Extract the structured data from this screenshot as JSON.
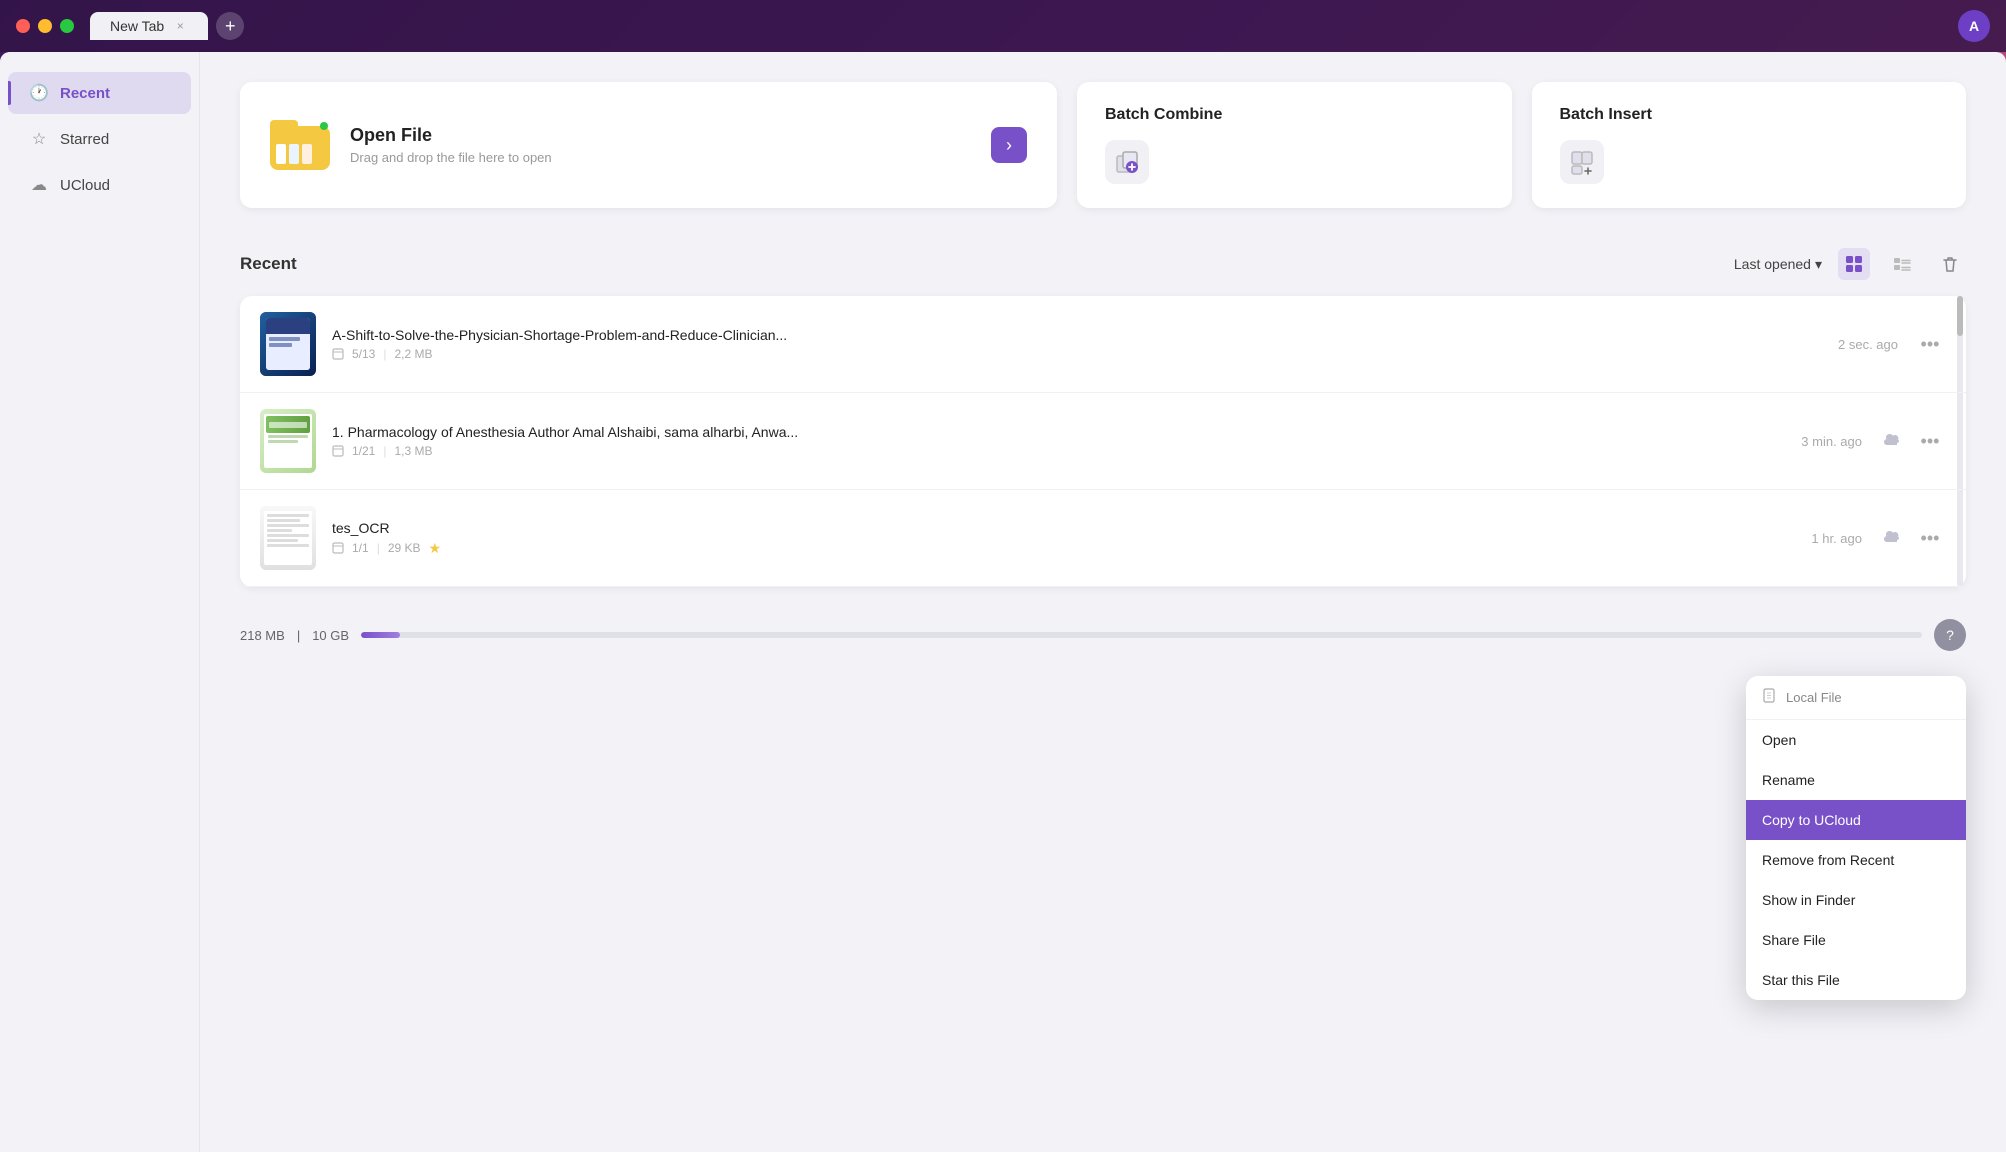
{
  "titlebar": {
    "tab_label": "New Tab",
    "tab_close_icon": "×",
    "tab_add_icon": "+",
    "avatar_label": "A"
  },
  "sidebar": {
    "items": [
      {
        "id": "recent",
        "label": "Recent",
        "icon": "🕐",
        "active": true
      },
      {
        "id": "starred",
        "label": "Starred",
        "icon": "☆",
        "active": false
      },
      {
        "id": "ucloud",
        "label": "UCloud",
        "icon": "☁",
        "active": false
      }
    ]
  },
  "quick_actions": {
    "open_file": {
      "title": "Open File",
      "subtitle": "Drag and drop the file here to open",
      "arrow": "›"
    },
    "batch_combine": {
      "title": "Batch Combine"
    },
    "batch_insert": {
      "title": "Batch Insert"
    }
  },
  "recent_section": {
    "title": "Recent",
    "sort_label": "Last opened",
    "sort_arrow": "▾"
  },
  "files": [
    {
      "name": "A-Shift-to-Solve-the-Physician-Shortage-Problem-and-Reduce-Clinician...",
      "pages": "5/13",
      "size": "2,2 MB",
      "time": "2 sec. ago",
      "has_cloud": false,
      "starred": false,
      "thumb_type": "medical"
    },
    {
      "name": "1. Pharmacology of Anesthesia Author Amal Alshaibi, sama alharbi, Anwa...",
      "pages": "1/21",
      "size": "1,3 MB",
      "time": "3 min. ago",
      "has_cloud": true,
      "starred": false,
      "thumb_type": "pharma"
    },
    {
      "name": "tes_OCR",
      "pages": "1/1",
      "size": "29 KB",
      "time": "1 hr. ago",
      "has_cloud": true,
      "starred": true,
      "thumb_type": "ocr"
    }
  ],
  "bottom_bar": {
    "used_storage": "218 MB",
    "total_storage": "10 GB",
    "storage_percent": 2.5
  },
  "context_menu": {
    "header_label": "Local File",
    "items": [
      {
        "id": "open",
        "label": "Open",
        "highlighted": false
      },
      {
        "id": "rename",
        "label": "Rename",
        "highlighted": false
      },
      {
        "id": "copy-to-ucloud",
        "label": "Copy to UCloud",
        "highlighted": true
      },
      {
        "id": "remove-from-recent",
        "label": "Remove from Recent",
        "highlighted": false
      },
      {
        "id": "show-in-finder",
        "label": "Show in Finder",
        "highlighted": false
      },
      {
        "id": "share-file",
        "label": "Share File",
        "highlighted": false
      },
      {
        "id": "star-this-file",
        "label": "Star this File",
        "highlighted": false
      }
    ]
  },
  "icons": {
    "clock": "🕐",
    "star_outline": "☆",
    "cloud": "☁",
    "arrow_right": "›",
    "chevron_down": "▾",
    "grid_view": "⊞",
    "list_view": "☰",
    "trash": "🗑",
    "more": "•••",
    "help": "?",
    "local_file_icon": "📄",
    "batch_combine_icon": "⊕",
    "batch_insert_icon": "⊡"
  }
}
